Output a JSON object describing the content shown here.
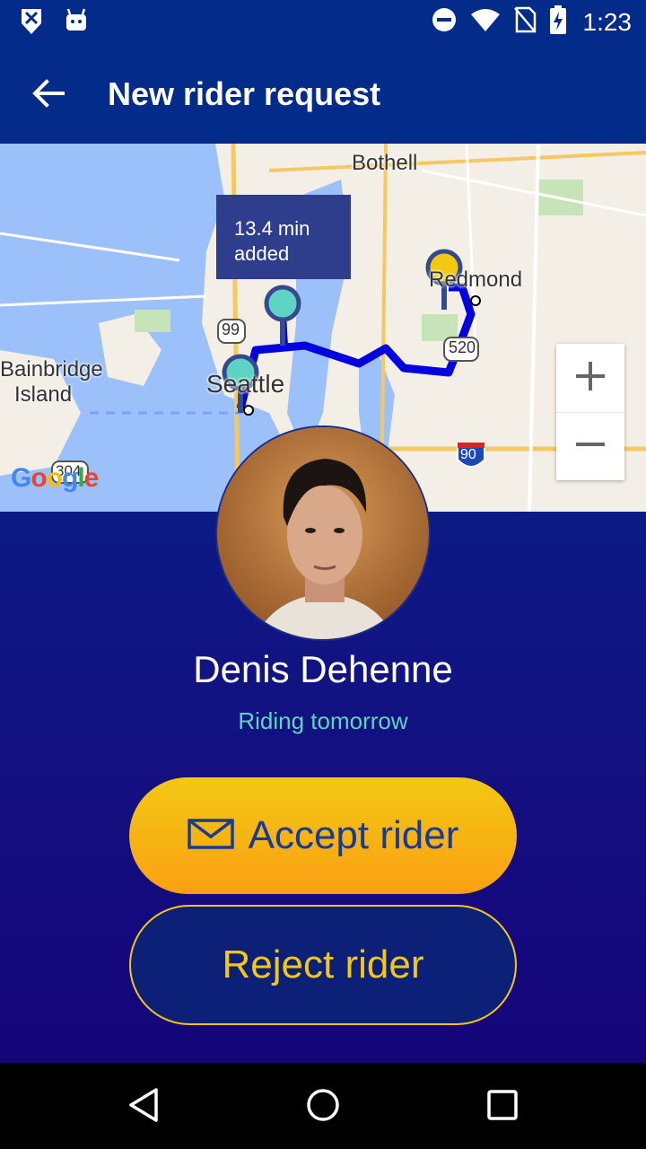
{
  "status_bar": {
    "time": "1:23",
    "left_icons": [
      "notification-icon",
      "android-icon"
    ],
    "right_icons": [
      "dnd-icon",
      "wifi-icon",
      "no-sim-icon",
      "battery-charging-icon"
    ]
  },
  "app_bar": {
    "title": "New rider request",
    "back_icon": "arrow-left-icon"
  },
  "map": {
    "tooltip_line1": "13.4 min",
    "tooltip_line2": "added",
    "labels": {
      "bothell": "Bothell",
      "redmond": "Redmond",
      "seattle": "Seattle",
      "bainbridge1": "Bainbridge",
      "bainbridge2": "Island"
    },
    "shields": [
      "99",
      "520",
      "90",
      "304"
    ],
    "zoom_in": "+",
    "zoom_out": "−",
    "google_logo": "Google",
    "route_color": "#0000e0"
  },
  "rider": {
    "name": "Denis Dehenne",
    "status": "Riding tomorrow"
  },
  "actions": {
    "accept_label": "Accept rider",
    "accept_icon": "envelope-icon",
    "reject_label": "Reject rider"
  },
  "nav_bar": {
    "buttons": [
      "back-triangle-icon",
      "home-circle-icon",
      "recents-square-icon"
    ]
  },
  "colors": {
    "primary": "#032b8a",
    "accent_yellow": "#f2c813",
    "accent_teal": "#5fd3c3",
    "accent_orange": "#fba013"
  }
}
